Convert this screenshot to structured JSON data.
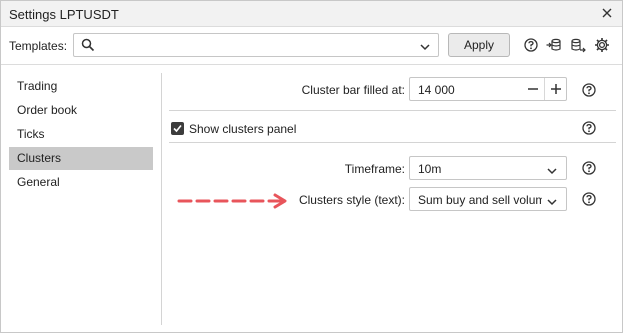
{
  "window": {
    "title": "Settings LPTUSDT"
  },
  "toolbar": {
    "templates_label": "Templates:",
    "templates_value": "",
    "apply_label": "Apply"
  },
  "sidebar": {
    "items": [
      {
        "label": "Trading"
      },
      {
        "label": "Order book"
      },
      {
        "label": "Ticks"
      },
      {
        "label": "Clusters"
      },
      {
        "label": "General"
      }
    ],
    "active": "Clusters"
  },
  "settings": {
    "cluster_bar": {
      "label": "Cluster bar filled at:",
      "value": "14 000"
    },
    "show_clusters_panel": {
      "label": "Show clusters panel",
      "checked": true
    },
    "timeframe": {
      "label": "Timeframe:",
      "value": "10m"
    },
    "clusters_style": {
      "label": "Clusters style (text):",
      "value": "Sum buy and sell volum"
    }
  },
  "colors": {
    "annotation_arrow": "#e8555b",
    "active_sidebar": "#c9c9c9",
    "checkbox": "#3c3c3c"
  },
  "icons": [
    "close-icon",
    "search-icon",
    "chevron-down-icon",
    "help-icon",
    "import-icon",
    "export-icon",
    "gear-icon",
    "minus-icon",
    "plus-icon",
    "checkmark-icon",
    "annotation-arrow"
  ]
}
